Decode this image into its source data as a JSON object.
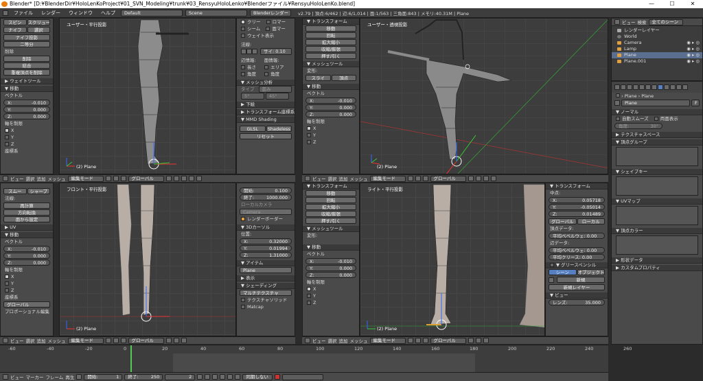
{
  "title_bar": {
    "text": "Blender* [D:¥BlenderDir¥HoloLenKoProject¥01_SVN_Modeling¥trunk¥03_RensyuHoloLenko¥Blenderファイル¥RensyuHoloLenKo.blend]",
    "min": "—",
    "max": "☐",
    "close": "✕"
  },
  "menu": {
    "items": [
      "ファイル",
      "レンダー",
      "ウィンドウ",
      "ヘルプ"
    ],
    "layout": "Default",
    "scene": "Scene",
    "engine": "Blenderレンダー",
    "stats": "v2.79 | 頂点:6/462 | 辺:6/1,014 | 面:1/563 | 三角面:843 | メモリ:40.31M | Plane"
  },
  "tl_left": {
    "items": [
      "スピン",
      "スクリュー",
      "ナイフ",
      "選択",
      "ナイフ投影",
      "二等分"
    ],
    "del_label": "削除",
    "del_btn": "削除",
    "merge_btn": "結合",
    "remdup_btn": "重複頂点を削除",
    "weight_tools": "▶ ウェイトツール",
    "move_hdr": "▼ 移動",
    "vector": "ベクトル",
    "x": "X:",
    "xv": "-0.010",
    "y": "Y:",
    "yv": "0.000",
    "z": "Z:",
    "zv": "0.000",
    "constraint": "軸を制限",
    "cx": "X",
    "cy": "Y",
    "cz": "Z",
    "coord": "座標系"
  },
  "vp_tl": {
    "title": "ユーザー・平行投影",
    "obj": "(2) Plane"
  },
  "vp_tr": {
    "title": "ユーザー・透視投影",
    "obj": "(2) Plane"
  },
  "vp_bl": {
    "title": "フロント・平行投影",
    "obj": "(2) Plane"
  },
  "vp_br": {
    "title": "ライト・平行投影",
    "obj": "(2) Plane"
  },
  "np_tl": {
    "cb": [
      "クリー",
      "ロマー",
      "シーム",
      "面マー",
      "ウェイト表示"
    ],
    "normal": "法線:",
    "size": "サイ: 0.10",
    "edgelen": "辺情報:",
    "faceinfo": "面情報:",
    "len": "長さ",
    "area": "エリア",
    "angle": "角度",
    "angle2": "角度",
    "mesh_analysis": "▼ メッシュ分析",
    "type": "タイプ",
    "type_val": "歪み",
    "min": "5°",
    "max": "45°",
    "lower": "▶ 下絵",
    "transform_coord": "▶ トランスフォーム座標系",
    "mmd": "▼ MMD Shading",
    "glsl": "GLSL",
    "shadeless": "Shadeless",
    "reset": "リセット"
  },
  "tl_tr": {
    "transform": "▼ トランスフォーム",
    "btns": [
      "移動",
      "回転",
      "拡大縮小",
      "収縮/膨張",
      "押す/引く"
    ],
    "mesh_tools": "▼ メッシュツール",
    "deform": "変形:",
    "slide": "スライ",
    "vert": "頂点",
    "move_hdr": "▼ 移動",
    "vector": "ベクトル",
    "xv": "-0.010",
    "yv": "0.000",
    "zv": "0.000",
    "constraint": "軸を制限"
  },
  "tl_bl": {
    "smooth": "スムー",
    "sharp": "シャープ",
    "normal": "法線:",
    "recalc": "再計算",
    "flip": "方向転換",
    "facesel": "面から設定",
    "uv": "▶ UV",
    "move_hdr": "▼ 移動",
    "vector": "ベクトル",
    "xv": "-0.010",
    "yv": "0.000",
    "zv": "0.000",
    "constraint": "軸を制限",
    "coord": "座標系",
    "global": "グローバル",
    "prop": "プロポーショナル編集"
  },
  "np_bl": {
    "start": "開始:",
    "start_v": "0.100",
    "end": "終了:",
    "end_v": "1000.000",
    "local_cam": "ローカルカメラ",
    "camera": "Camera",
    "render_border": "レンダーボーダー",
    "cursor": "▼ 3Dカーソル",
    "pos": "位置:",
    "x": "X:",
    "xv": "0.32000",
    "y": "Y:",
    "yv": "0.01994",
    "z": "Z:",
    "zv": "1.31000",
    "item": "▼ アイテム",
    "plane": "Plane",
    "display": "▶ 表示",
    "shading": "▼ シェーディング",
    "material": "マルチテクスチャ",
    "texsolid": "テクスチャソリッド",
    "matcap": "Matcap"
  },
  "tl_br": {
    "transform": "▼ トランスフォーム",
    "btns": [
      "移動",
      "回転",
      "拡大縮小",
      "収縮/膨張",
      "押す/引く"
    ],
    "mesh_tools": "▼ メッシュツール",
    "deform": "変形:",
    "move_hdr": "▼ 移動",
    "vector": "ベクトル",
    "xv": "-0.010",
    "yv": "0.000",
    "zv": "0.000",
    "constraint": "軸を制限"
  },
  "np_br": {
    "transform": "▼ トランスフォーム",
    "median": "中点:",
    "x": "X:",
    "xv": "0.05718",
    "y": "Y:",
    "yv": "-0.05014",
    "z": "Z:",
    "zv": "0.01489",
    "global": "グローバル",
    "local": "ローカル",
    "vdata": "頂点データ:",
    "bevw": "平均ベベルウェ: 0.00",
    "edata": "辺データ:",
    "bevw2": "平均ベベルウェ: 0.00",
    "crease": "平均クリース: 0.00",
    "grease": "▼ グリースペンシル",
    "scene": "シーン",
    "object": "オブジェクト",
    "new": "新規",
    "newlayer": "新規レイヤー",
    "view": "▼ ビュー",
    "lens": "レンズ:",
    "lens_v": "35.000"
  },
  "vp_header": {
    "view": "ビュー",
    "select": "選択",
    "add": "追加",
    "mesh": "メッシュ",
    "mode": "編集モード",
    "global": "グローバル"
  },
  "outliner": {
    "view": "ビュー",
    "search": "検索",
    "all_scenes": "全てのシーン",
    "items": [
      "レンダーレイヤー",
      "World",
      "Camera",
      "Lamp",
      "Plane",
      "Plane.001"
    ]
  },
  "props": {
    "plane": "Plane",
    "plane2": "Plane",
    "mesh_name": "Plane",
    "f": "F",
    "normal": "▼ ノーマル",
    "autosmooth": "自動スムーズ",
    "double": "両面表示",
    "angle": "角度:",
    "angle_v": "30°",
    "texspace": "▶ テクスチャスペース",
    "vgroup": "▼ 頂点グループ",
    "shapekey": "▼ シェイプキー",
    "uvmap": "▼ UVマップ",
    "vcolor": "▼ 頂点カラー",
    "geodata": "▶ 形状データ",
    "custom": "▶ カスタムプロパティ"
  },
  "timeline": {
    "ticks": [
      "-60",
      "-40",
      "-20",
      "0",
      "20",
      "40",
      "60",
      "80",
      "100",
      "120",
      "140",
      "160",
      "180",
      "200",
      "220",
      "240",
      "260"
    ],
    "view": "ビュー",
    "marker": "マーカー",
    "frame": "フレーム",
    "play": "再生",
    "start": "開始:",
    "start_v": "1",
    "end": "終了:",
    "end_v": "250",
    "cur": "2",
    "sync": "同期しない",
    "cursor_frame": 2
  }
}
